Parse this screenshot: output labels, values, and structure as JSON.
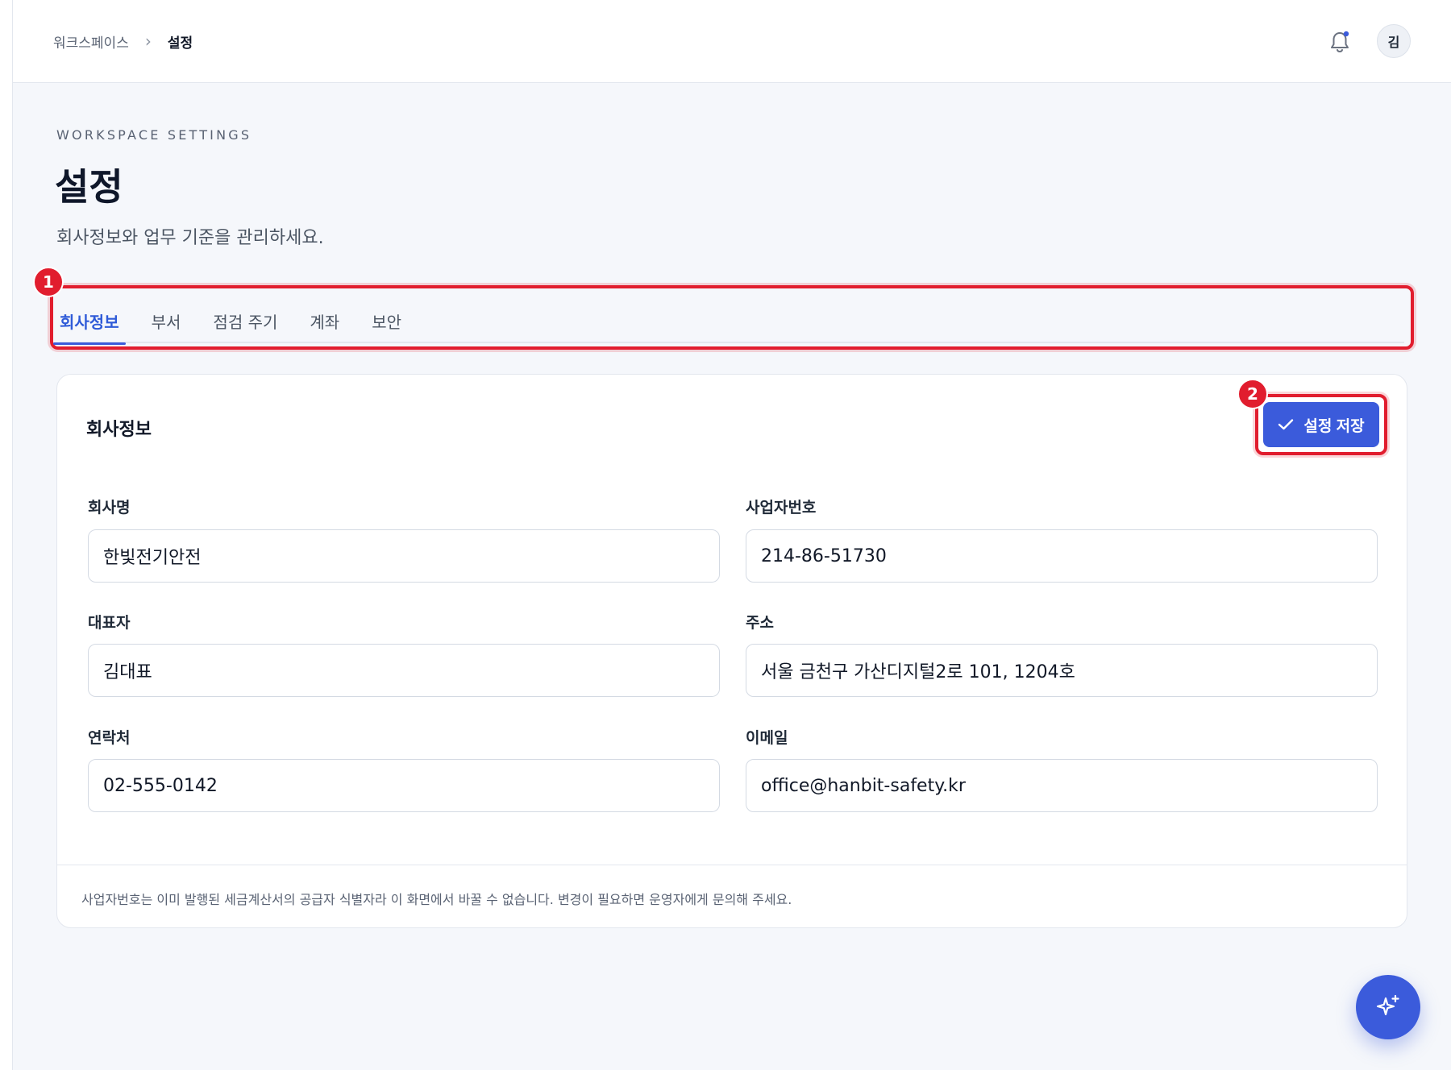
{
  "breadcrumb": {
    "root": "워크스페이스",
    "separator": "›",
    "current": "설정"
  },
  "header": {
    "avatar_initial": "김",
    "icons": [
      "bell-icon"
    ]
  },
  "page": {
    "eyebrow": "WORKSPACE SETTINGS",
    "title": "설정",
    "subtitle": "회사정보와 업무 기준을 관리하세요."
  },
  "tabs": [
    {
      "label": "회사정보",
      "active": true
    },
    {
      "label": "부서",
      "active": false
    },
    {
      "label": "점검 주기",
      "active": false
    },
    {
      "label": "계좌",
      "active": false
    },
    {
      "label": "보안",
      "active": false
    }
  ],
  "annotations": {
    "badge_1": "1",
    "badge_2": "2"
  },
  "card": {
    "title": "회사정보",
    "save_label": "설정 저장",
    "footnote": "사업자번호는 이미 발행된 세금계산서의 공급자 식별자라 이 화면에서 바꿀 수 없습니다. 변경이 필요하면 운영자에게 문의해 주세요."
  },
  "fields": {
    "company_name": {
      "label": "회사명",
      "value": "한빛전기안전"
    },
    "business_number": {
      "label": "사업자번호",
      "value": "214-86-51730"
    },
    "representative": {
      "label": "대표자",
      "value": "김대표"
    },
    "address": {
      "label": "주소",
      "value": "서울 금천구 가산디지털2로 101, 1204호"
    },
    "phone": {
      "label": "연락처",
      "value": "02-555-0142"
    },
    "email": {
      "label": "이메일",
      "value": "office@hanbit-safety.kr"
    }
  },
  "colors": {
    "accent": "#3b5bdb",
    "annotation": "#e11d2e",
    "background": "#f5f7fb"
  },
  "fab_icon": "sparkle-icon"
}
